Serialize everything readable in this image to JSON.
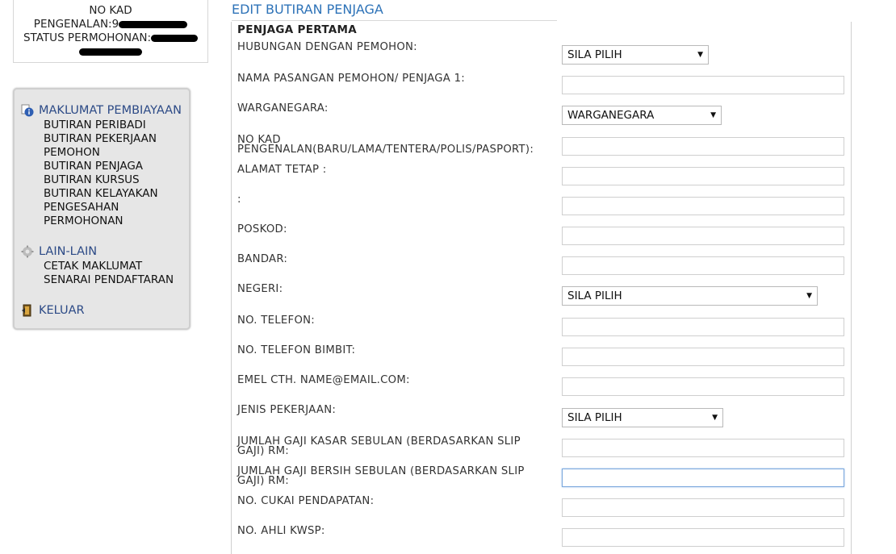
{
  "applicant": {
    "no_kad_label": "NO KAD",
    "pengenalan_label": "PENGENALAN:",
    "pengenalan_partial": "9",
    "status_label": "STATUS PERMOHONAN:"
  },
  "menu": {
    "sections": [
      {
        "icon": "info-icon",
        "title": "MAKLUMAT PEMBIAYAAN",
        "items": [
          "BUTIRAN PERIBADI",
          "BUTIRAN PEKERJAAN",
          "PEMOHON",
          "BUTIRAN PENJAGA",
          "BUTIRAN KURSUS",
          "BUTIRAN KELAYAKAN",
          "PENGESAHAN",
          "PERMOHONAN"
        ]
      },
      {
        "icon": "gear-icon",
        "title": "LAIN-LAIN",
        "items": [
          "CETAK MAKLUMAT",
          "SENARAI PENDAFTARAN"
        ]
      },
      {
        "icon": "exit-door-icon",
        "title": "KELUAR",
        "items": []
      }
    ]
  },
  "form": {
    "title": "EDIT BUTIRAN PENJAGA",
    "section_title": "PENJAGA PERTAMA",
    "fields": [
      {
        "label": "HUBUNGAN DENGAN PEMOHON:",
        "type": "select",
        "value": "SILA PILIH"
      },
      {
        "label": "NAMA PASANGAN PEMOHON/ PENJAGA 1:",
        "type": "text",
        "value": ""
      },
      {
        "label": "WARGANEGARA:",
        "type": "select",
        "value": "WARGANEGARA"
      },
      {
        "label": "NO KAD PENGENALAN(BARU/LAMA/TENTERA/POLIS/PASPORT):",
        "type": "text",
        "value": ""
      },
      {
        "label": "ALAMAT TETAP :",
        "type": "text",
        "value": ""
      },
      {
        "label": ":",
        "type": "text",
        "value": ""
      },
      {
        "label": "POSKOD:",
        "type": "text",
        "value": ""
      },
      {
        "label": "BANDAR:",
        "type": "text",
        "value": ""
      },
      {
        "label": "NEGERI:",
        "type": "select",
        "value": "SILA PILIH"
      },
      {
        "label": "NO. TELEFON:",
        "type": "text",
        "value": ""
      },
      {
        "label": "NO. TELEFON BIMBIT:",
        "type": "text",
        "value": ""
      },
      {
        "label": "EMEL CTH. NAME@EMAIL.COM:",
        "type": "text",
        "value": ""
      },
      {
        "label": "JENIS PEKERJAAN:",
        "type": "select",
        "value": "SILA PILIH"
      },
      {
        "label": "JUMLAH GAJI KASAR SEBULAN (BERDASARKAN SLIP GAJI) RM:",
        "type": "text",
        "value": ""
      },
      {
        "label": "JUMLAH GAJI BERSIH SEBULAN (BERDASARKAN SLIP GAJI) RM:",
        "type": "text",
        "value": ""
      },
      {
        "label": "NO. CUKAI PENDAPATAN:",
        "type": "text",
        "value": ""
      },
      {
        "label": "NO. AHLI KWSP:",
        "type": "text",
        "value": ""
      }
    ]
  }
}
